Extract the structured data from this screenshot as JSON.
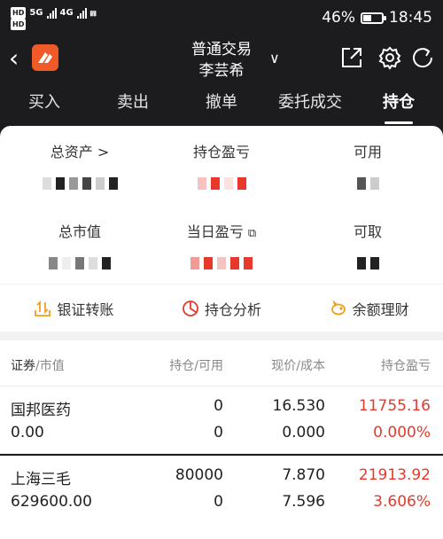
{
  "status_bar": {
    "net1": "HD",
    "net2": "HD",
    "net_type_1": "5G",
    "net_type_2": "4G",
    "battery": "46%",
    "battery_level": 0.46,
    "time": "18:45"
  },
  "nav": {
    "title": "普通交易",
    "account": "李芸希"
  },
  "tabs": [
    "买入",
    "卖出",
    "撤单",
    "委托成交",
    "持仓"
  ],
  "summary": {
    "total_assets": "总资产 >",
    "holding_pl": "持仓盈亏",
    "available": "可用",
    "market_value": "总市值",
    "daily_pl": "当日盈亏",
    "withdrawable": "可取"
  },
  "actions": [
    "银证转账",
    "持仓分析",
    "余额理财"
  ],
  "table": {
    "headers": {
      "col1_a": "证券",
      "col1_b": "/市值",
      "col2": "持仓/可用",
      "col3": "现价/成本",
      "col4": "持仓盈亏"
    },
    "rows": [
      {
        "name": "国邦医药",
        "value": "0.00",
        "position": "0",
        "available": "0",
        "price": "16.530",
        "cost": "0.000",
        "pl": "11755.16",
        "pl_pct": "0.000%"
      },
      {
        "name": "上海三毛",
        "value": "629600.00",
        "position": "80000",
        "available": "0",
        "price": "7.870",
        "cost": "7.596",
        "pl": "21913.92",
        "pl_pct": "3.606%"
      }
    ]
  },
  "colors": {
    "header_bg": "#1c1c1e",
    "accent": "#f05a28",
    "profit_red": "#e8382b"
  }
}
